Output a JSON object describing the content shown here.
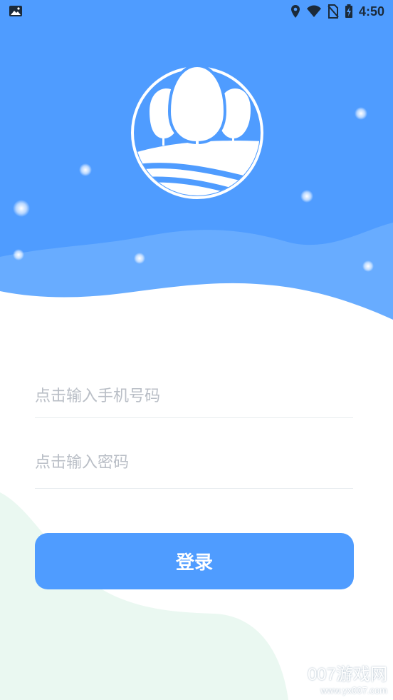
{
  "status_bar": {
    "time": "4:50",
    "icons": [
      "gallery-icon",
      "location-icon",
      "wifi-icon",
      "no-sim-icon",
      "battery-charging-icon"
    ]
  },
  "login_form": {
    "phone_placeholder": "点击输入手机号码",
    "password_placeholder": "点击输入密码",
    "login_label": "登录"
  },
  "watermark": {
    "brand": "007游戏网",
    "url": "www.yx007.com"
  },
  "colors": {
    "primary": "#4f9cff",
    "header_wave": "#6aaeff",
    "mint_accent": "#eaf8f1",
    "divider": "#e8ecef"
  }
}
